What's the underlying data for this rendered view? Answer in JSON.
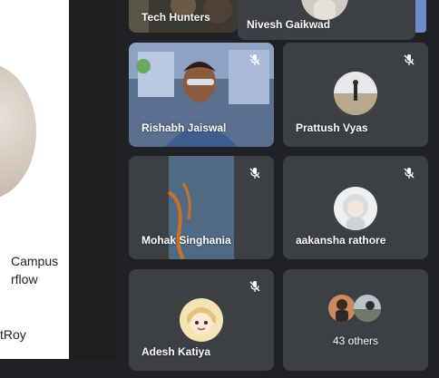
{
  "slide": {
    "line1": "Campus",
    "line2": "rflow",
    "line3": "tRoy"
  },
  "tiles": {
    "top_left_name": "Tech Hunters",
    "top_right_name": "Nivesh Gaikwad",
    "rishabh": "Rishabh Jaiswal",
    "prattush": "Prattush Vyas",
    "mohak": "Mohak Singhania",
    "aakansha": "aakansha rathore",
    "adesh": "Adesh Katiya",
    "others": "43 others"
  },
  "colors": {
    "background": "#202124",
    "tile": "#3c4043",
    "text": "#ffffff"
  },
  "icons": {
    "mic_muted": "mic-off-icon"
  }
}
